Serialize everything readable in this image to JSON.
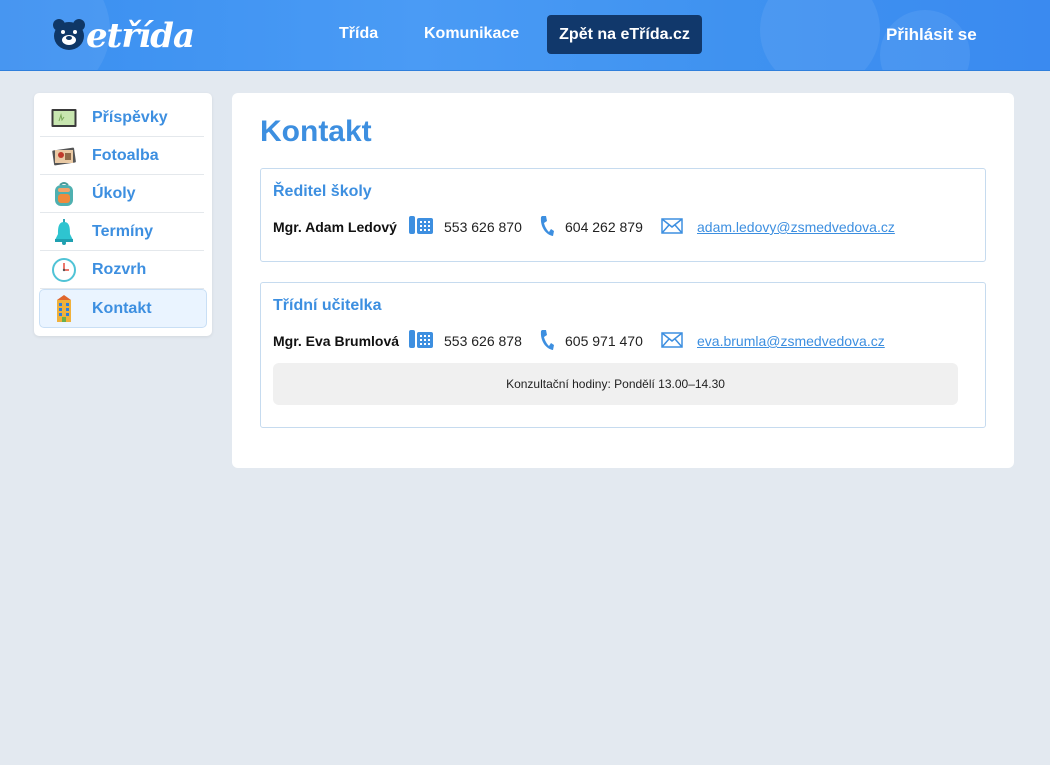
{
  "header": {
    "logo_text": "etřída",
    "nav": [
      {
        "label": "Třída"
      },
      {
        "label": "Komunikace"
      }
    ],
    "back_button": "Zpět na eTřída.cz",
    "login": "Přihlásit se"
  },
  "sidebar": {
    "items": [
      {
        "label": "Příspěvky",
        "icon": "board-icon"
      },
      {
        "label": "Fotoalba",
        "icon": "photo-album-icon"
      },
      {
        "label": "Úkoly",
        "icon": "backpack-icon"
      },
      {
        "label": "Termíny",
        "icon": "bell-icon"
      },
      {
        "label": "Rozvrh",
        "icon": "clock-icon"
      },
      {
        "label": "Kontakt",
        "icon": "school-building-icon",
        "active": true
      }
    ]
  },
  "main": {
    "title": "Kontakt",
    "contacts": [
      {
        "role": "Ředitel školy",
        "name": "Mgr. Adam Ledový",
        "phone": "553 626 870",
        "mobile": "604 262 879",
        "email": "adam.ledovy@zsmedvedova.cz"
      },
      {
        "role": "Třídní učitelka",
        "name": "Mgr. Eva Brumlová",
        "phone": "553 626 878",
        "mobile": "605 971 470",
        "email": "eva.brumla@zsmedvedova.cz",
        "note": "Konzultační hodiny: Pondělí 13.00–14.30"
      }
    ]
  },
  "colors": {
    "header_blue": "#3f92f0",
    "accent": "#3d8fe0",
    "dark_button": "#11386b",
    "background": "#e3e9f0"
  }
}
